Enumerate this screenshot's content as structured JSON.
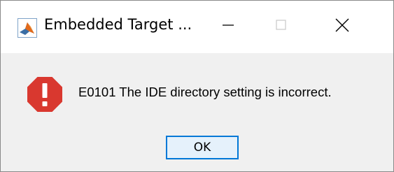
{
  "window": {
    "title": "Embedded Target ...",
    "app_icon": "matlab-logo-icon",
    "controls": {
      "minimize_icon": "minimize-icon",
      "maximize_icon": "maximize-icon",
      "close_icon": "close-icon"
    }
  },
  "dialog": {
    "icon": "error-icon",
    "message": "E0101 The IDE directory setting is incorrect.",
    "ok_label": "OK"
  },
  "colors": {
    "error_red": "#d9382f",
    "button_border": "#0078d7",
    "button_fill": "#e5f1fb",
    "dialog_background": "#f0f0f0"
  }
}
